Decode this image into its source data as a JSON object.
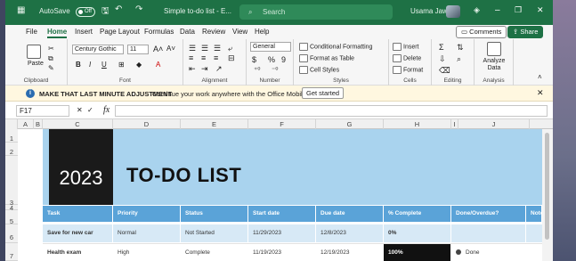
{
  "titlebar": {
    "autosave_label": "AutoSave",
    "autosave_state": "Off",
    "file_name": "Simple to-do list - E...",
    "search_placeholder": "Search",
    "user_name": "Usama Jawad",
    "minimize": "–",
    "restore": "❐",
    "close": "✕"
  },
  "menu": {
    "items": [
      "File",
      "Home",
      "Insert",
      "Page Layout",
      "Formulas",
      "Data",
      "Review",
      "View",
      "Help"
    ],
    "comments": "Comments",
    "share": "Share"
  },
  "ribbon": {
    "clipboard": {
      "paste": "Paste",
      "label": "Clipboard"
    },
    "font": {
      "family": "Century Gothic",
      "size": "11",
      "bold": "B",
      "italic": "I",
      "underline": "U",
      "label": "Font"
    },
    "alignment": {
      "label": "Alignment"
    },
    "number": {
      "format": "General",
      "currency": "$",
      "percent": "%",
      "comma": "9",
      "label": "Number"
    },
    "styles": {
      "conditional": "Conditional Formatting",
      "table": "Format as Table",
      "cell": "Cell Styles",
      "label": "Styles"
    },
    "cells": {
      "insert": "Insert",
      "delete": "Delete",
      "format": "Format",
      "label": "Cells"
    },
    "editing": {
      "sum": "Σ",
      "label": "Editing"
    },
    "analysis": {
      "analyze": "Analyze Data",
      "label": "Analysis"
    }
  },
  "infobar": {
    "title": "MAKE THAT LAST MINUTE ADJUSTMENT",
    "message": "Continue your work anywhere with the Office Mobile App",
    "button": "Get started"
  },
  "formula_bar": {
    "name_box": "F17",
    "fx": "fx",
    "content": ""
  },
  "columns": [
    "A",
    "B",
    "C",
    "D",
    "E",
    "F",
    "G",
    "H",
    "I",
    "J"
  ],
  "rows": [
    "1",
    "2",
    "3",
    "4",
    "5",
    "6",
    "7"
  ],
  "sheet": {
    "year": "2023",
    "title": "TO-DO LIST",
    "headers": [
      "Task",
      "Priority",
      "Status",
      "Start date",
      "Due date",
      "% Complete",
      "Done/Overdue?",
      "Notes"
    ],
    "tasks": [
      {
        "task": "Save for new car",
        "priority": "Normal",
        "status": "Not Started",
        "start": "11/29/2023",
        "due": "12/8/2023",
        "complete": "0%",
        "done": ""
      },
      {
        "task": "Health exam",
        "priority": "High",
        "status": "Complete",
        "start": "11/19/2023",
        "due": "12/19/2023",
        "complete": "100%",
        "done": "Done"
      }
    ]
  },
  "colors": {
    "excel_green": "#1e7145",
    "banner": "#a9d3ee",
    "header_row": "#5aa3d8",
    "row_light": "#d7e9f6"
  }
}
